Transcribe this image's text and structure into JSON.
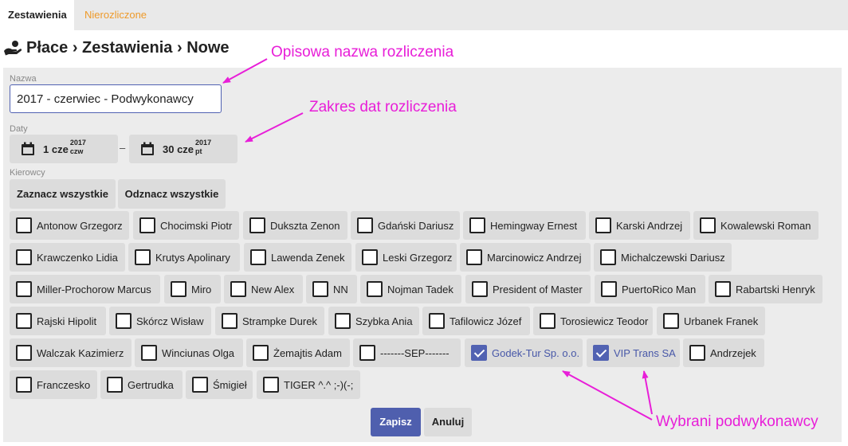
{
  "tabs": [
    {
      "label": "Zestawienia",
      "active": true
    },
    {
      "label": "Nierozliczone",
      "active": false
    }
  ],
  "breadcrumb": "Płace › Zestawienia › Nowe",
  "form": {
    "name_label": "Nazwa",
    "name_value": "2017 - czerwiec - Podwykonawcy",
    "dates_label": "Daty",
    "date_from": {
      "day": "1 cze",
      "year": "2017",
      "weekday": "czw"
    },
    "date_separator": "–",
    "date_to": {
      "day": "30 cze",
      "year": "2017",
      "weekday": "pt"
    },
    "drivers_label": "Kierowcy",
    "select_all": "Zaznacz wszystkie",
    "deselect_all": "Odznacz wszystkie",
    "drivers": [
      {
        "name": "Antonow Grzegorz",
        "checked": false
      },
      {
        "name": "Chocimski Piotr",
        "checked": false
      },
      {
        "name": "Dukszta Zenon",
        "checked": false
      },
      {
        "name": "Gdański Dariusz",
        "checked": false
      },
      {
        "name": "Hemingway Ernest",
        "checked": false
      },
      {
        "name": "Karski Andrzej",
        "checked": false
      },
      {
        "name": "Kowalewski Roman",
        "checked": false
      },
      {
        "name": "Krawczenko Lidia",
        "checked": false
      },
      {
        "name": "Krutys Apolinary",
        "checked": false
      },
      {
        "name": "Lawenda Zenek",
        "checked": false
      },
      {
        "name": "Leski Grzegorz",
        "checked": false
      },
      {
        "name": "Marcinowicz Andrzej",
        "checked": false
      },
      {
        "name": "Michalczewski Dariusz",
        "checked": false
      },
      {
        "name": "Miller-Prochorow Marcus",
        "checked": false
      },
      {
        "name": "Miro",
        "checked": false
      },
      {
        "name": "New Alex",
        "checked": false
      },
      {
        "name": "NN",
        "checked": false
      },
      {
        "name": "Nojman Tadek",
        "checked": false
      },
      {
        "name": "President of Master",
        "checked": false
      },
      {
        "name": "PuertoRico Man",
        "checked": false
      },
      {
        "name": "Rabartski Henryk",
        "checked": false
      },
      {
        "name": "Rajski Hipolit",
        "checked": false
      },
      {
        "name": "Skórcz Wisław",
        "checked": false
      },
      {
        "name": "Strampke Durek",
        "checked": false
      },
      {
        "name": "Szybka Ania",
        "checked": false
      },
      {
        "name": "Tafilowicz Józef",
        "checked": false
      },
      {
        "name": "Torosiewicz Teodor",
        "checked": false
      },
      {
        "name": "Urbanek Franek",
        "checked": false
      },
      {
        "name": "Walczak Kazimierz",
        "checked": false
      },
      {
        "name": "Winciunas Olga",
        "checked": false
      },
      {
        "name": "Żemajtis Adam",
        "checked": false
      },
      {
        "name": "-------SEP-------",
        "checked": false
      },
      {
        "name": "Godek-Tur Sp. o.o.",
        "checked": true
      },
      {
        "name": "VIP Trans SA",
        "checked": true
      },
      {
        "name": "Andrzejek",
        "checked": false
      },
      {
        "name": "Franczesko",
        "checked": false
      },
      {
        "name": "Gertrudka",
        "checked": false
      },
      {
        "name": "Śmigieł",
        "checked": false
      },
      {
        "name": "TIGER ^.^ ;-)(-;",
        "checked": false
      }
    ],
    "save": "Zapisz",
    "cancel": "Anuluj"
  },
  "annotations": {
    "name": "Opisowa nazwa rozliczenia",
    "dates": "Zakres dat rozliczenia",
    "subcontractors": "Wybrani podwykonawcy"
  },
  "colors": {
    "accent": "#5162b2",
    "tab_inactive": "#ee9a2a",
    "annotation": "#e81ed8"
  }
}
